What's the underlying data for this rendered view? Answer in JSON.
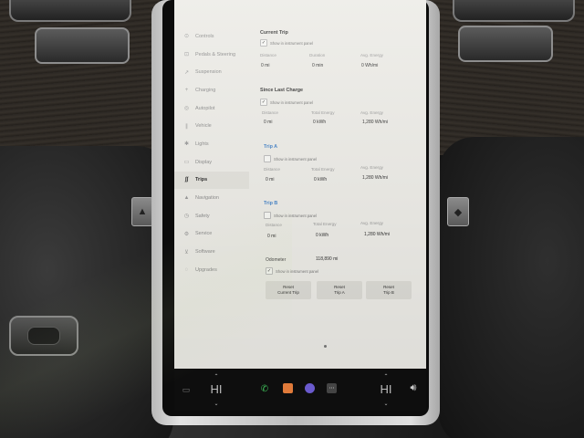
{
  "sidebar": {
    "items": [
      {
        "label": "Controls",
        "icon": "toggle-icon",
        "glyph": "⊙"
      },
      {
        "label": "Pedals & Steering",
        "icon": "car-icon",
        "glyph": "⊡"
      },
      {
        "label": "Suspension",
        "icon": "wrench-icon",
        "glyph": "↗"
      },
      {
        "label": "Charging",
        "icon": "bolt-icon",
        "glyph": "+"
      },
      {
        "label": "Autopilot",
        "icon": "steering-wheel-icon",
        "glyph": "◎"
      },
      {
        "label": "Vehicle",
        "icon": "vehicle-icon",
        "glyph": "∥"
      },
      {
        "label": "Lights",
        "icon": "lightbulb-icon",
        "glyph": "✱"
      },
      {
        "label": "Display",
        "icon": "display-icon",
        "glyph": "▭"
      },
      {
        "label": "Trips",
        "icon": "trips-icon",
        "glyph": "∫∫"
      },
      {
        "label": "Navigation",
        "icon": "navigation-icon",
        "glyph": "▲"
      },
      {
        "label": "Safety",
        "icon": "safety-icon",
        "glyph": "◷"
      },
      {
        "label": "Service",
        "icon": "service-icon",
        "glyph": "⚙"
      },
      {
        "label": "Software",
        "icon": "software-icon",
        "glyph": "⊻"
      },
      {
        "label": "Upgrades",
        "icon": "upgrades-icon",
        "glyph": "◌"
      }
    ],
    "active_index": 8
  },
  "current_trip": {
    "title": "Current Trip",
    "show_label": "Show in instrument panel",
    "checked": true,
    "distance_label": "Distance",
    "distance_value": "0 mi",
    "duration_label": "Duration",
    "duration_value": "0 min",
    "avg_label": "Avg. Energy",
    "avg_value": "0 Wh/mi"
  },
  "since_last_charge": {
    "title": "Since Last Charge",
    "show_label": "Show in instrument panel",
    "checked": true,
    "distance_label": "Distance",
    "distance_value": "0 mi",
    "energy_label": "Total Energy",
    "energy_value": "0 kWh",
    "avg_label": "Avg. Energy",
    "avg_value": "1,280 Wh/mi"
  },
  "trip_a": {
    "title": "Trip A",
    "show_label": "Show in instrument panel",
    "checked": false,
    "distance_label": "Distance",
    "distance_value": "0 mi",
    "energy_label": "Total Energy",
    "energy_value": "0 kWh",
    "avg_label": "Avg. Energy",
    "avg_value": "1,280 Wh/mi"
  },
  "trip_b": {
    "title": "Trip B",
    "show_label": "Show in instrument panel",
    "checked": false,
    "distance_label": "Distance",
    "distance_value": "0 mi",
    "energy_label": "Total Energy",
    "energy_value": "0 kWh",
    "avg_label": "Avg. Energy",
    "avg_value": "1,280 Wh/mi"
  },
  "odometer": {
    "label": "Odometer",
    "value": "118,890 mi",
    "show_label": "Show in instrument panel",
    "checked": true
  },
  "buttons": {
    "reset_current": "Reset\nCurrent Trip",
    "reset_a": "Reset\nTrip A",
    "reset_b": "Reset\nTrip B"
  },
  "bottom_bar": {
    "temp_left": "HI",
    "temp_right": "HI",
    "phone_color": "#3fbf5a",
    "media_color": "#e07a3a",
    "camera_color": "#6a5acd"
  }
}
